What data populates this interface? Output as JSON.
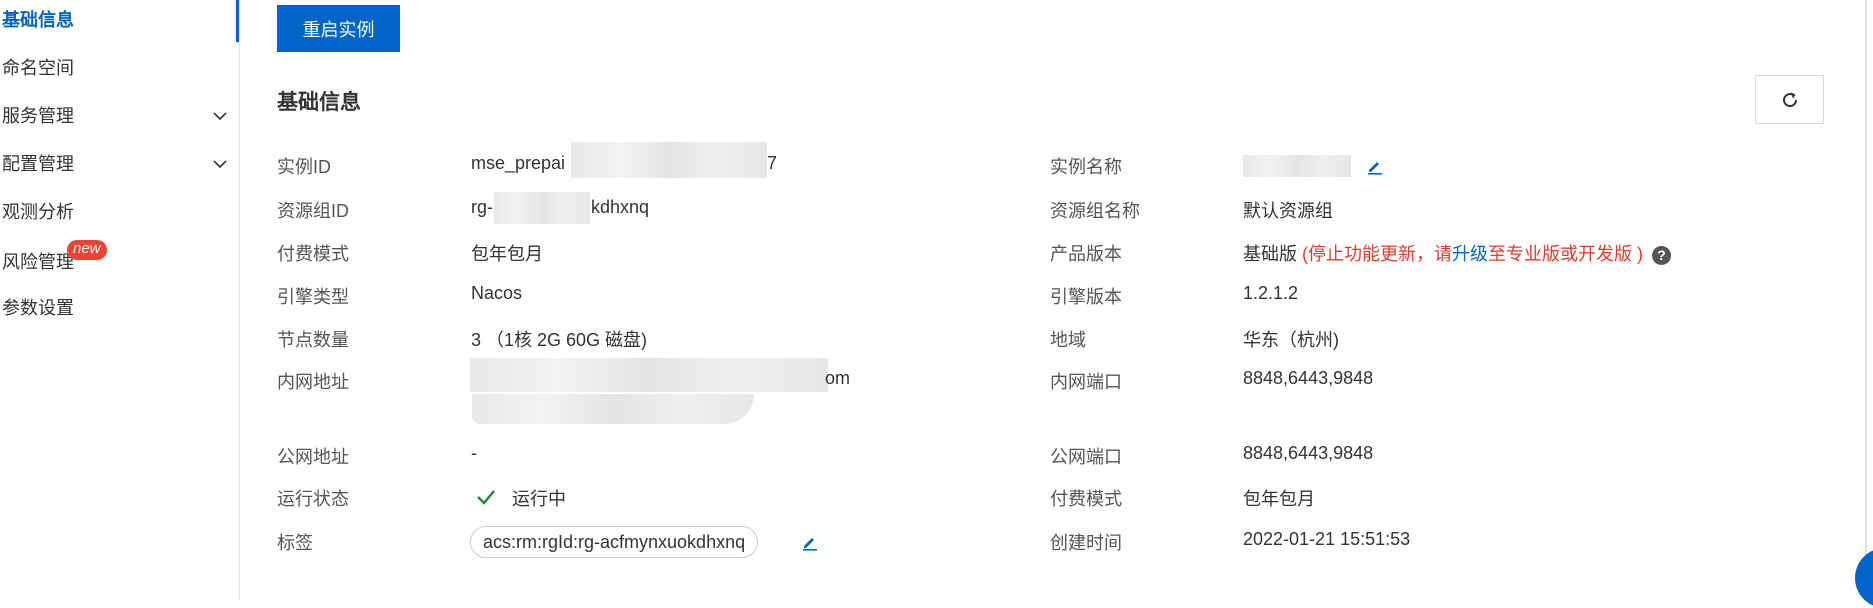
{
  "sidebar": {
    "items": [
      {
        "label": "基础信息",
        "active": true
      },
      {
        "label": "命名空间"
      },
      {
        "label": "服务管理",
        "expandable": true
      },
      {
        "label": "配置管理",
        "expandable": true
      },
      {
        "label": "观测分析"
      },
      {
        "label": "风险管理",
        "badge": "new"
      },
      {
        "label": "参数设置"
      }
    ]
  },
  "toolbar": {
    "restart_label": "重启实例"
  },
  "section": {
    "title": "基础信息"
  },
  "fields": {
    "instance_id_label": "实例ID",
    "instance_id_prefix": "mse_prepai",
    "instance_id_suffix": "7",
    "resource_group_id_label": "资源组ID",
    "resource_group_id_prefix": "rg-",
    "resource_group_id_suffix": "kdhxnq",
    "billing_mode_label": "付费模式",
    "billing_mode_value": "包年包月",
    "engine_type_label": "引擎类型",
    "engine_type_value": "Nacos",
    "node_count_label": "节点数量",
    "node_count_value": "3 （1核 2G 60G 磁盘)",
    "internal_address_label": "内网地址",
    "internal_address_suffix": "om",
    "public_address_label": "公网地址",
    "public_address_value": "-",
    "run_status_label": "运行状态",
    "run_status_value": "运行中",
    "tags_label": "标签",
    "tags_value": "acs:rm:rgId:rg-acfmynxuokdhxnq",
    "instance_name_label": "实例名称",
    "resource_group_name_label": "资源组名称",
    "resource_group_name_value": "默认资源组",
    "product_version_label": "产品版本",
    "product_version_value": "基础版",
    "product_version_warn_prefix": "(停止功能更新，请",
    "product_version_warn_link": "升级",
    "product_version_warn_suffix": "至专业版或开发版 )",
    "engine_version_label": "引擎版本",
    "engine_version_value": "1.2.1.2",
    "region_label": "地域",
    "region_value": "华东（杭州)",
    "internal_port_label": "内网端口",
    "internal_port_value": "8848,6443,9848",
    "public_port_label": "公网端口",
    "public_port_value": "8848,6443,9848",
    "billing_mode2_label": "付费模式",
    "billing_mode2_value": "包年包月",
    "created_time_label": "创建时间",
    "created_time_value": "2022-01-21 15:51:53"
  },
  "colors": {
    "accent": "#0064c8",
    "warn": "#e23b2a",
    "success": "#1a8a2e",
    "badge": "#f04134"
  }
}
